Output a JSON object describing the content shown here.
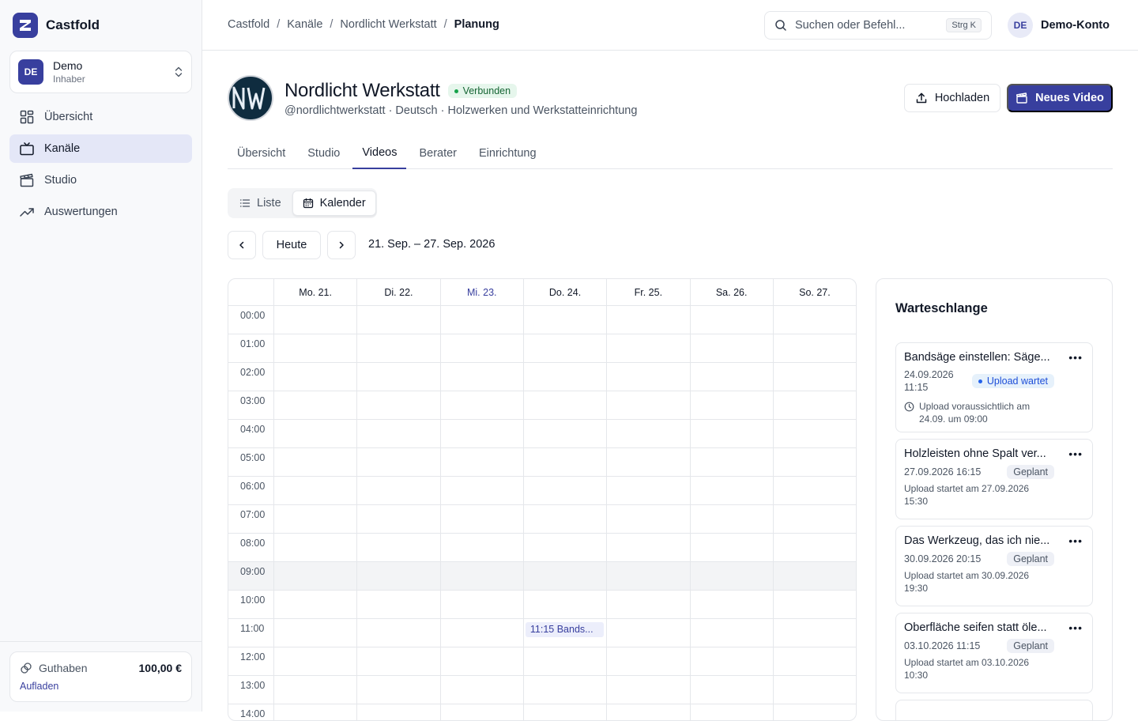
{
  "app": {
    "name": "Castfold",
    "colors": {
      "accent": "#383f9e",
      "success": "#16a34a",
      "info": "#2563eb"
    }
  },
  "workspace": {
    "avatar": "DE",
    "name": "Demo",
    "role": "Inhaber"
  },
  "sidebar": {
    "items": [
      {
        "label": "Übersicht",
        "icon": "grid-icon"
      },
      {
        "label": "Kanäle",
        "icon": "tv-icon",
        "active": true
      },
      {
        "label": "Studio",
        "icon": "clapperboard-icon"
      },
      {
        "label": "Auswertungen",
        "icon": "trend-up-icon"
      }
    ],
    "credit": {
      "label": "Guthaben",
      "value": "100,00 €",
      "link": "Aufladen"
    }
  },
  "topbar": {
    "breadcrumb": [
      "Castfold",
      "Kanäle",
      "Nordlicht Werkstatt",
      "Planung"
    ],
    "search": {
      "placeholder": "Suchen oder Befehl...",
      "shortcut": "Strg K"
    },
    "account": {
      "avatar": "DE",
      "name": "Demo-Konto"
    }
  },
  "channel": {
    "title": "Nordlicht Werkstatt",
    "status": "Verbunden",
    "subtitle": "@nordlichtwerkstatt · Deutsch · Holzwerken und Werkstatteinrichtung",
    "upload_label": "Hochladen",
    "new_video_label": "Neues Video"
  },
  "tabs": [
    {
      "label": "Übersicht"
    },
    {
      "label": "Studio"
    },
    {
      "label": "Videos",
      "active": true
    },
    {
      "label": "Berater"
    },
    {
      "label": "Einrichtung"
    }
  ],
  "view_toggle": {
    "list": "Liste",
    "calendar": "Kalender",
    "active": "calendar"
  },
  "calendar": {
    "today_label": "Heute",
    "range": "21. Sep. – 27. Sep. 2026",
    "days": [
      "Mo. 21.",
      "Di. 22.",
      "Mi. 23.",
      "Do. 24.",
      "Fr. 25.",
      "Sa. 26.",
      "So. 27."
    ],
    "today_index": 2,
    "hours": [
      "00:00",
      "01:00",
      "02:00",
      "03:00",
      "04:00",
      "05:00",
      "06:00",
      "07:00",
      "08:00",
      "09:00",
      "10:00",
      "11:00",
      "12:00",
      "13:00",
      "14:00"
    ],
    "highlight_hour": 9,
    "events": [
      {
        "label": "11:15 Bands...",
        "day_index": 3,
        "hour": 11
      }
    ]
  },
  "queue": {
    "title": "Warteschlange",
    "items": [
      {
        "title": "Bandsäge einstellen: Säge...",
        "date": "24.09.2026",
        "time": "11:15",
        "status": "Upload wartet",
        "status_type": "waiting",
        "note": "Upload voraussichtlich am 24.09. um 09:00"
      },
      {
        "title": "Holzleisten ohne Spalt ver...",
        "date": "27.09.2026 16:15",
        "status": "Geplant",
        "status_type": "planned",
        "note": "Upload startet am 27.09.2026 15:30"
      },
      {
        "title": "Das Werkzeug, das ich nie...",
        "date": "30.09.2026 20:15",
        "status": "Geplant",
        "status_type": "planned",
        "note": "Upload startet am 30.09.2026 19:30"
      },
      {
        "title": "Oberfläche seifen statt öle...",
        "date": "03.10.2026 11:15",
        "status": "Geplant",
        "status_type": "planned",
        "note": "Upload startet am 03.10.2026 10:30"
      }
    ]
  }
}
